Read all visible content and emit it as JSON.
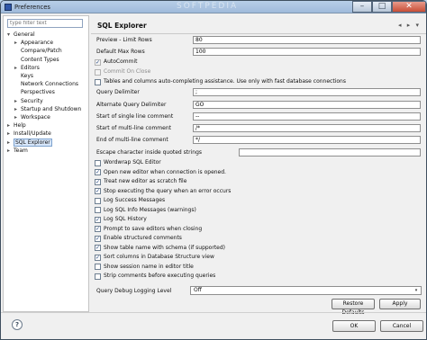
{
  "window": {
    "title": "Preferences",
    "watermark": "SOFTPEDIA",
    "controls": {
      "minimize": "–",
      "maximize": "□",
      "close": "✕"
    }
  },
  "left_panel": {
    "filter_placeholder": "type filter text",
    "tree": [
      {
        "label": "General",
        "arrow": "▾",
        "level": 0
      },
      {
        "label": "Appearance",
        "arrow": "▸",
        "level": 1
      },
      {
        "label": "Compare/Patch",
        "arrow": "",
        "level": 1
      },
      {
        "label": "Content Types",
        "arrow": "",
        "level": 1
      },
      {
        "label": "Editors",
        "arrow": "▸",
        "level": 1
      },
      {
        "label": "Keys",
        "arrow": "",
        "level": 1
      },
      {
        "label": "Network Connections",
        "arrow": "",
        "level": 1
      },
      {
        "label": "Perspectives",
        "arrow": "",
        "level": 1
      },
      {
        "label": "Security",
        "arrow": "▸",
        "level": 1
      },
      {
        "label": "Startup and Shutdown",
        "arrow": "▸",
        "level": 1
      },
      {
        "label": "Workspace",
        "arrow": "▸",
        "level": 1
      },
      {
        "label": "Help",
        "arrow": "▸",
        "level": 0
      },
      {
        "label": "Install/Update",
        "arrow": "▸",
        "level": 0
      },
      {
        "label": "SQL Explorer",
        "arrow": "▸",
        "level": 0,
        "selected": true
      },
      {
        "label": "Team",
        "arrow": "▸",
        "level": 0
      }
    ]
  },
  "page": {
    "title": "SQL Explorer",
    "nav": "◂ ▸ ▾",
    "fields": [
      {
        "label": "Preview - Limit Rows",
        "value": "80"
      },
      {
        "label": "Default Max Rows",
        "value": "100"
      }
    ],
    "top_checkboxes": [
      {
        "label": "AutoCommit",
        "checked": true,
        "disabled": true
      },
      {
        "label": "Commit On Close",
        "checked": false,
        "disabled": true
      },
      {
        "label": "Tables and columns auto-completing assistance. Use only with fast database connections",
        "checked": false,
        "disabled": false
      }
    ],
    "text_fields": [
      {
        "label": "Query Delimiter",
        "value": ";"
      },
      {
        "label": "Alternate Query Delimiter",
        "value": "GO"
      },
      {
        "label": "Start of single line comment",
        "value": "--"
      },
      {
        "label": "Start of multi-line comment",
        "value": "/*"
      },
      {
        "label": "End of multi-line comment",
        "value": "*/"
      },
      {
        "label": "Escape character inside quoted strings",
        "value": ""
      }
    ],
    "checkboxes": [
      {
        "label": "Wordwrap SQL Editor",
        "checked": false
      },
      {
        "label": "Open new editor when connection is opened.",
        "checked": true
      },
      {
        "label": "Treat new editor as scratch file",
        "checked": true
      },
      {
        "label": "Stop executing the query when an error occurs",
        "checked": true
      },
      {
        "label": "Log Success Messages",
        "checked": false
      },
      {
        "label": "Log SQL Info Messages (warnings)",
        "checked": false
      },
      {
        "label": "Log SQL History",
        "checked": true
      },
      {
        "label": "Prompt to save editors when closing",
        "checked": true
      },
      {
        "label": "Enable structured comments",
        "checked": true
      },
      {
        "label": "Show table name with schema (if supported)",
        "checked": true
      },
      {
        "label": "Sort columns in Database Structure view",
        "checked": true
      },
      {
        "label": "Show session name in editor title",
        "checked": false
      },
      {
        "label": "Strip comments before executing queries",
        "checked": false
      }
    ],
    "logging": {
      "label": "Query Debug Logging Level",
      "value": "Off",
      "arrow": "▾"
    },
    "restore_defaults": "Restore Defaults",
    "apply": "Apply"
  },
  "footer": {
    "help": "?",
    "ok": "OK",
    "cancel": "Cancel"
  }
}
